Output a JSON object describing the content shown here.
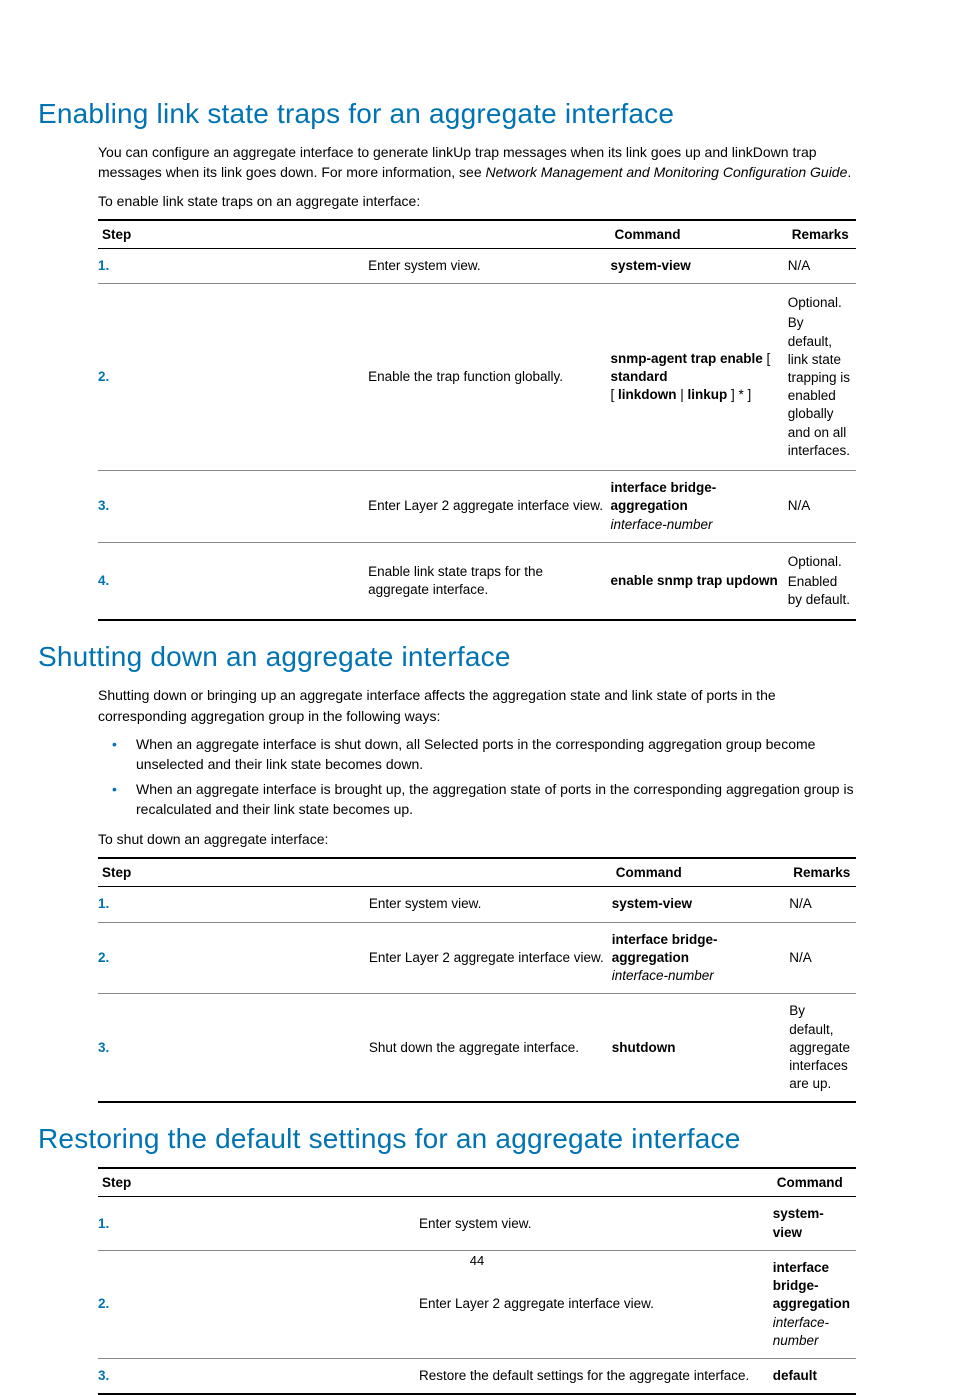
{
  "page_number": "44",
  "section1": {
    "title": "Enabling link state traps for an aggregate interface",
    "p1_a": "You can configure an aggregate interface to generate linkUp trap messages when its link goes up and linkDown trap messages when its link goes down. For more information, see ",
    "p1_i": "Network Management and Monitoring Configuration Guide",
    "p1_b": ".",
    "p2": "To enable link state traps on an aggregate interface:",
    "headers": {
      "step": "Step",
      "command": "Command",
      "remarks": "Remarks"
    },
    "rows": [
      {
        "n": "1.",
        "step": "Enter system view.",
        "cmd_b": "system-view",
        "cmd_i": "",
        "remarks": "N/A"
      },
      {
        "n": "2.",
        "step": "Enable the trap function globally.",
        "cmd_b1": "snmp-agent trap enable",
        "cmd_mid1": " [ ",
        "cmd_b2": "standard",
        "cmd_mid2": " [ ",
        "cmd_b3": "linkdown",
        "cmd_mid3": " | ",
        "cmd_b4": "linkup",
        "cmd_mid4": " ] * ]",
        "remarks_l1": "Optional.",
        "remarks_l2": "By default, link state trapping is enabled globally and on all interfaces."
      },
      {
        "n": "3.",
        "step": "Enter Layer 2 aggregate interface view.",
        "cmd_b": "interface bridge-aggregation",
        "cmd_i": "interface-number",
        "remarks": "N/A"
      },
      {
        "n": "4.",
        "step": "Enable link state traps for the aggregate interface.",
        "cmd_b": "enable snmp trap updown",
        "cmd_i": "",
        "remarks_l1": "Optional.",
        "remarks_l2": "Enabled by default."
      }
    ]
  },
  "section2": {
    "title": "Shutting down an aggregate interface",
    "p1": "Shutting down or bringing up an aggregate interface affects the aggregation state and link state of ports in the corresponding aggregation group in the following ways:",
    "b1": "When an aggregate interface is shut down, all Selected ports in the corresponding aggregation group become unselected and their link state becomes down.",
    "b2": "When an aggregate interface is brought up, the aggregation state of ports in the corresponding aggregation group is recalculated and their link state becomes up.",
    "p2": "To shut down an aggregate interface:",
    "headers": {
      "step": "Step",
      "command": "Command",
      "remarks": "Remarks"
    },
    "rows": [
      {
        "n": "1.",
        "step": "Enter system view.",
        "cmd_b": "system-view",
        "cmd_i": "",
        "remarks": "N/A"
      },
      {
        "n": "2.",
        "step": "Enter Layer 2 aggregate interface view.",
        "cmd_b": "interface bridge-aggregation",
        "cmd_i": "interface-number",
        "remarks": "N/A"
      },
      {
        "n": "3.",
        "step": "Shut down the aggregate interface.",
        "cmd_b": "shutdown",
        "cmd_i": "",
        "remarks": "By default, aggregate interfaces are up."
      }
    ]
  },
  "section3": {
    "title": "Restoring the default settings for an aggregate interface",
    "headers": {
      "step": "Step",
      "command": "Command"
    },
    "rows": [
      {
        "n": "1.",
        "step": "Enter system view.",
        "cmd_b": "system-view",
        "cmd_i": ""
      },
      {
        "n": "2.",
        "step": "Enter Layer 2 aggregate interface view.",
        "cmd_b": "interface bridge-aggregation",
        "cmd_i": " interface-number"
      },
      {
        "n": "3.",
        "step": "Restore the default settings for the aggregate interface.",
        "cmd_b": "default",
        "cmd_i": ""
      }
    ]
  }
}
